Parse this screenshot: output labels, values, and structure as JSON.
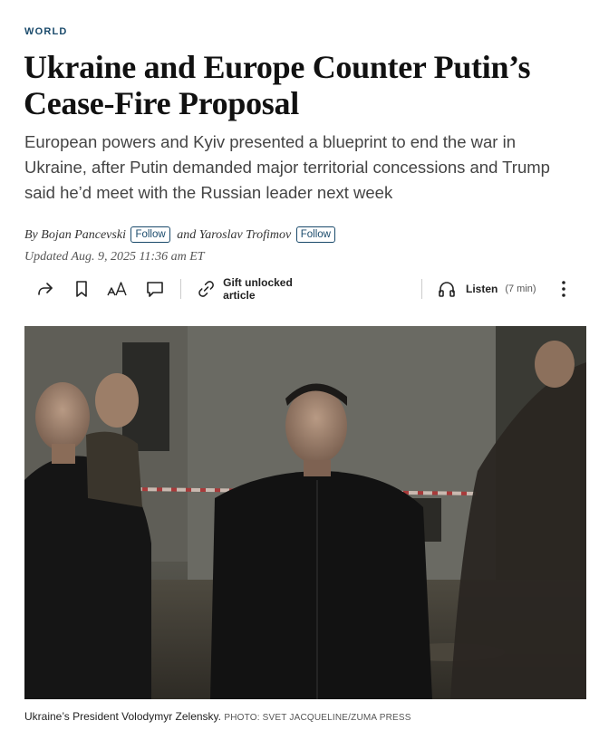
{
  "article": {
    "section": "WORLD",
    "headline": "Ukraine and Europe Counter Putin’s Cease-Fire Proposal",
    "dek": "European powers and Kyiv presented a blueprint to end the war in Ukraine, after Putin demanded major territorial concessions and Trump said he’d meet with the Russian leader next week",
    "byline": {
      "by": "By",
      "author1": "Bojan Pancevski",
      "follow": "Follow",
      "and": "and",
      "author2": "Yaroslav Trofimov"
    },
    "updated": "Updated Aug. 9, 2025 11:36 am ET"
  },
  "toolbar": {
    "share_icon": "share-icon",
    "bookmark_icon": "bookmark-icon",
    "text_size_icon": "text-size-icon",
    "comment_icon": "comment-icon",
    "gift_label": "Gift unlocked article",
    "listen_label": "Listen",
    "listen_time": "(7 min)",
    "more_icon": "more-vertical-icon"
  },
  "photo": {
    "caption": "Ukraine’s President Volodymyr Zelensky.",
    "credit": "PHOTO: SVET JACQUELINE/ZUMA PRESS"
  }
}
